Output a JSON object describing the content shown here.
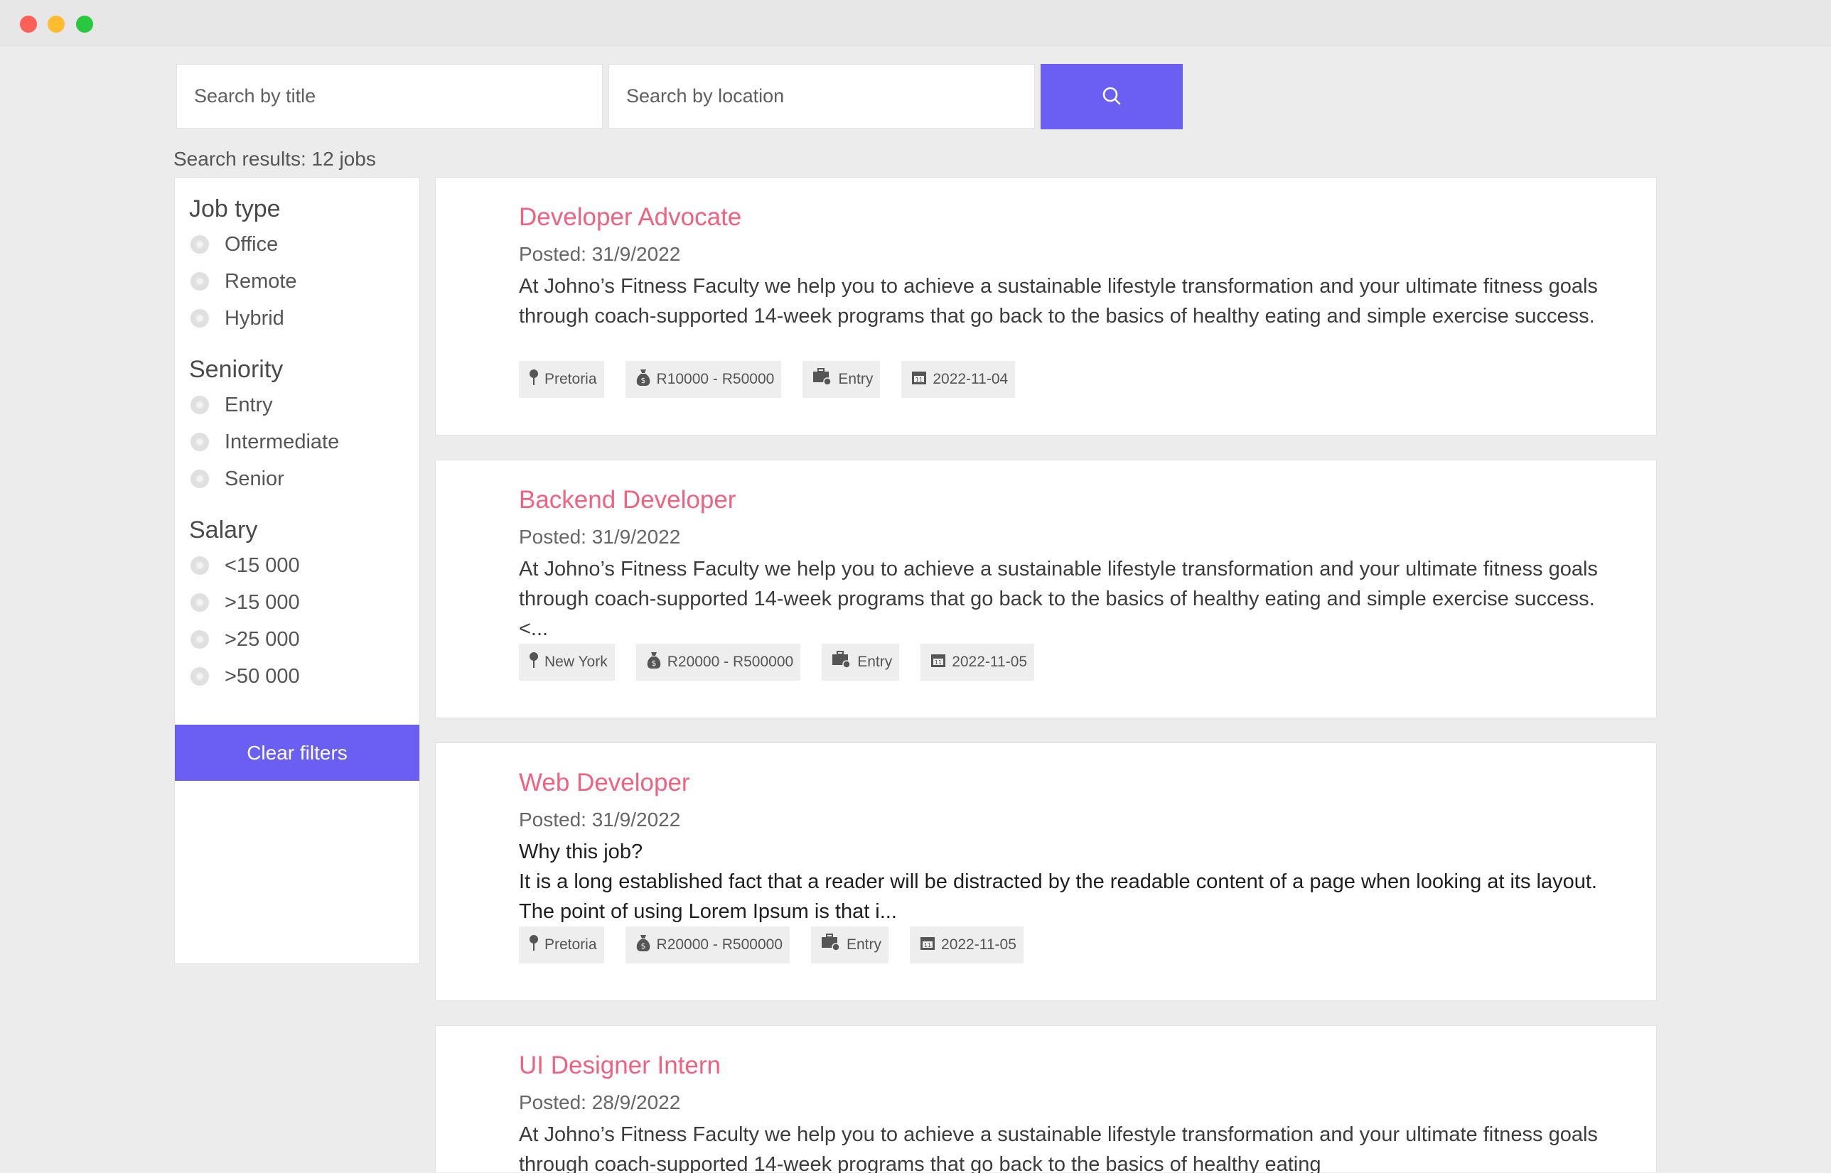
{
  "search": {
    "title_placeholder": "Search by title",
    "location_placeholder": "Search by location",
    "results_text": "Search results: 12 jobs"
  },
  "filters": {
    "job_type": {
      "heading": "Job type",
      "options": [
        "Office",
        "Remote",
        "Hybrid"
      ]
    },
    "seniority": {
      "heading": "Seniority",
      "options": [
        "Entry",
        "Intermediate",
        "Senior"
      ]
    },
    "salary": {
      "heading": "Salary",
      "options": [
        "<15 000",
        ">15 000",
        ">25 000",
        ">50 000"
      ]
    },
    "clear_label": "Clear filters"
  },
  "jobs": [
    {
      "title": "Developer Advocate",
      "posted": "Posted: 31/9/2022",
      "description": "At Johno’s Fitness Faculty we help you to achieve a sustainable lifestyle transformation and your ultimate fitness goals through coach-supported 14-week programs that go back to the basics of healthy eating and simple exercise success.",
      "location": "Pretoria",
      "salary": "R10000 - R50000",
      "level": "Entry",
      "date": "2022-11-04"
    },
    {
      "title": "Backend Developer",
      "posted": "Posted: 31/9/2022",
      "description": "At Johno’s Fitness Faculty we help you to achieve a sustainable lifestyle transformation and your ultimate fitness goals through coach-supported 14-week programs that go back to the basics of healthy eating and simple exercise success.<...",
      "location": "New York",
      "salary": "R20000 - R500000",
      "level": "Entry",
      "date": "2022-11-05"
    },
    {
      "title": "Web Developer",
      "posted": "Posted: 31/9/2022",
      "description": "Why this job?\nIt is a long established fact that a reader will be distracted by the readable content of a page when looking at its layout. The point of using Lorem Ipsum is that i...",
      "location": "Pretoria",
      "salary": "R20000 - R500000",
      "level": "Entry",
      "date": "2022-11-05"
    },
    {
      "title": "UI Designer Intern",
      "posted": "Posted: 28/9/2022",
      "description": "At Johno’s Fitness Faculty we help you to achieve a sustainable lifestyle transformation and your ultimate fitness goals through coach-supported 14-week programs that go back to the basics of healthy eating",
      "location": "",
      "salary": "",
      "level": "",
      "date": ""
    }
  ]
}
